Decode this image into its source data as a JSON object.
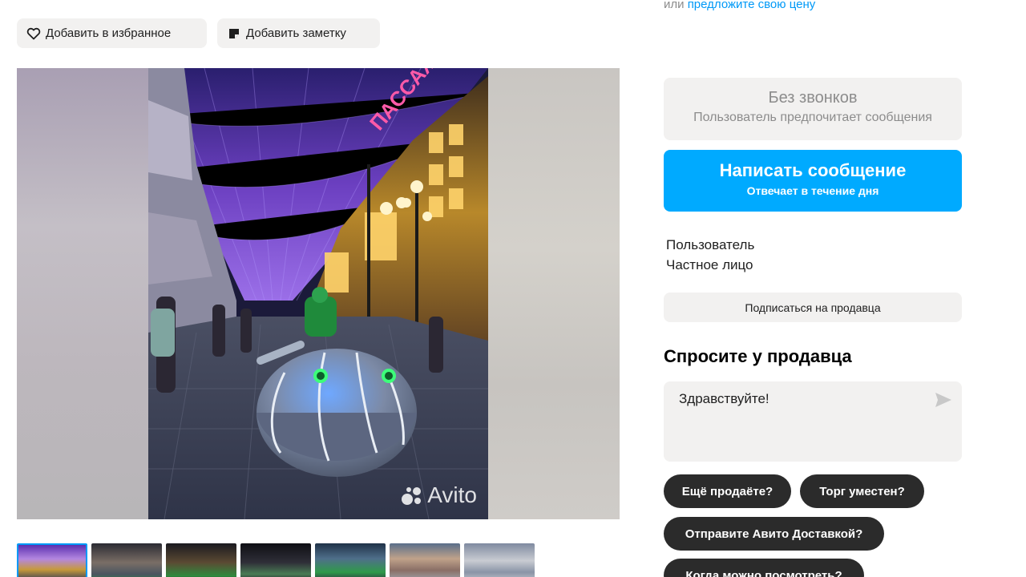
{
  "offer": {
    "prefix": "или",
    "link": "предложите свою цену"
  },
  "actions": {
    "favorite_label": "Добавить в избранное",
    "note_label": "Добавить заметку"
  },
  "gallery": {
    "watermark": "Avito",
    "thumbnail_count": 7,
    "active_thumbnail": 1
  },
  "contact": {
    "no_calls_title": "Без звонков",
    "no_calls_subtitle": "Пользователь предпочитает сообщения",
    "write_title": "Написать сообщение",
    "write_subtitle": "Отвечает в течение дня"
  },
  "seller": {
    "name": "Пользователь",
    "type": "Частное лицо",
    "subscribe_label": "Подписаться на продавца"
  },
  "ask": {
    "title": "Спросите у продавца",
    "message_value": "Здравствуйте!",
    "quick_questions": [
      "Ещё продаёте?",
      "Торг уместен?",
      "Отправите Авито Доставкой?",
      "Когда можно посмотреть?"
    ]
  },
  "colors": {
    "accent": "#00aaff",
    "link": "#0099f7",
    "chip_bg": "#2b2b2b",
    "button_bg": "#f2f1f0"
  }
}
